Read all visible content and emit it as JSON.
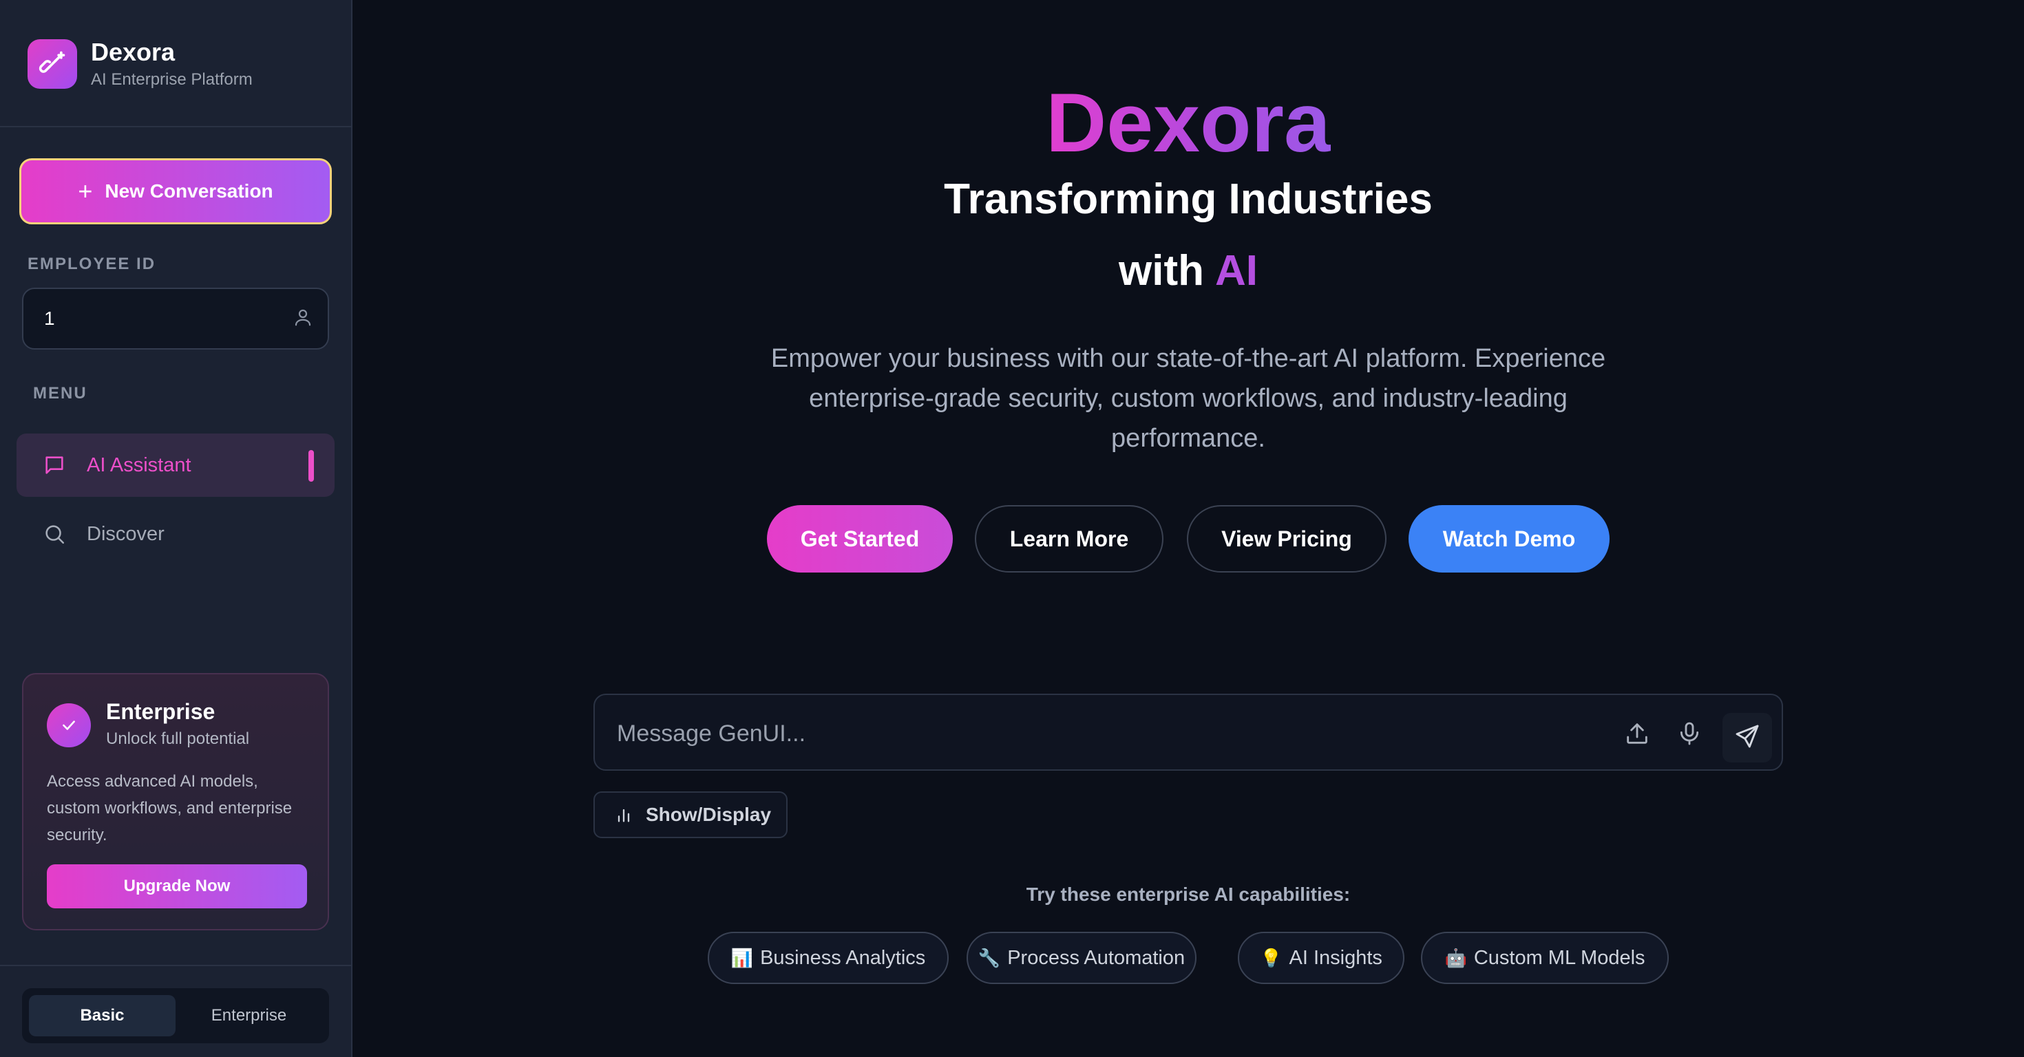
{
  "sidebar": {
    "brand_name": "Dexora",
    "brand_subtitle": "AI Enterprise Platform",
    "new_conversation_label": "New Conversation",
    "employee_id_label": "EMPLOYEE ID",
    "employee_id_value": "1",
    "menu_label": "MENU",
    "nav": [
      {
        "label": "AI Assistant",
        "icon": "chat-bubble-icon",
        "active": true
      },
      {
        "label": "Discover",
        "icon": "search-icon",
        "active": false
      }
    ],
    "enterprise_card": {
      "title": "Enterprise",
      "subtitle": "Unlock full potential",
      "description": "Access advanced AI models, custom workflows, and enterprise security.",
      "button_label": "Upgrade Now"
    },
    "plan_toggle": {
      "options": [
        "Basic",
        "Enterprise"
      ],
      "selected": "Basic"
    }
  },
  "hero": {
    "title": "Dexora",
    "subtitle_line1": "Transforming Industries",
    "subtitle_line2_prefix": "with",
    "subtitle_line2_highlight": "AI",
    "description": "Empower your business with our state-of-the-art AI platform. Experience enterprise-grade security, custom workflows, and industry-leading performance.",
    "buttons": [
      "Get Started",
      "Learn More",
      "View Pricing",
      "Watch Demo"
    ]
  },
  "composer": {
    "placeholder": "Message GenUI...",
    "show_display_label": "Show/Display"
  },
  "suggestions": {
    "label": "Try these enterprise AI capabilities:",
    "chips": [
      {
        "emoji": "📊",
        "label": "Business Analytics"
      },
      {
        "emoji": "🔧",
        "label": "Process Automation"
      },
      {
        "emoji": "💡",
        "label": "AI Insights"
      },
      {
        "emoji": "🤖",
        "label": "Custom ML Models"
      }
    ]
  },
  "colors": {
    "background": "#0b0f19",
    "sidebar": "#1b2232",
    "accent_pink": "#e53dc9",
    "accent_purple": "#a35cf2",
    "accent_blue": "#3b82f6"
  }
}
